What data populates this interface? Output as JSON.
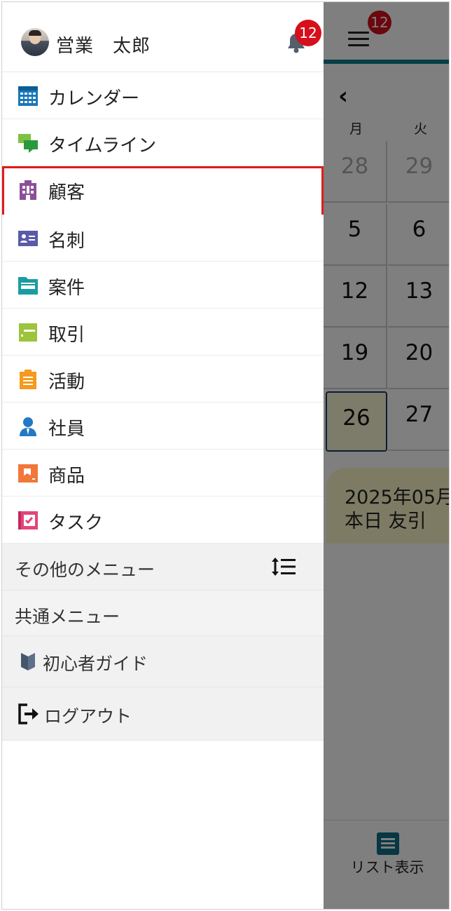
{
  "user": {
    "name": "営業　太郎"
  },
  "notifications": {
    "count": "12"
  },
  "menu": {
    "items": [
      {
        "label": "カレンダー",
        "icon": "calendar-icon"
      },
      {
        "label": "タイムライン",
        "icon": "chat-bubbles-icon"
      },
      {
        "label": "顧客",
        "icon": "building-icon",
        "selected": true
      },
      {
        "label": "名刺",
        "icon": "business-card-icon"
      },
      {
        "label": "案件",
        "icon": "folder-icon"
      },
      {
        "label": "取引",
        "icon": "ticket-icon"
      },
      {
        "label": "活動",
        "icon": "clipboard-icon"
      },
      {
        "label": "社員",
        "icon": "person-icon"
      },
      {
        "label": "商品",
        "icon": "product-tag-icon"
      },
      {
        "label": "タスク",
        "icon": "task-check-icon"
      }
    ],
    "other_menu": "その他のメニュー",
    "common_menu": "共通メニュー",
    "guide": "初心者ガイド",
    "logout": "ログアウト"
  },
  "background": {
    "badge": "12",
    "weekdays": [
      "月",
      "火"
    ],
    "calendar_days": [
      [
        "28",
        "29"
      ],
      [
        "5",
        "6"
      ],
      [
        "12",
        "13"
      ],
      [
        "19",
        "20"
      ],
      [
        "26",
        "27"
      ]
    ],
    "event_lines": [
      "2025年05月",
      "本日 友引"
    ],
    "list_view_label": "リスト表示"
  },
  "colors": {
    "selection_border": "#e01b1b",
    "badge": "#d60f1c",
    "accent": "#0d7f8f",
    "today_fill": "#fbf6d4"
  }
}
